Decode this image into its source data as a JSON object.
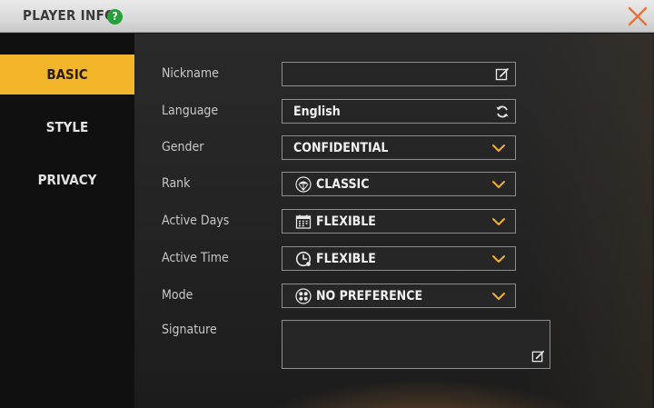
{
  "header": {
    "title": "PLAYER INFO",
    "help_glyph": "?"
  },
  "sidebar": {
    "tabs": [
      {
        "label": "BASIC",
        "active": true
      },
      {
        "label": "STYLE",
        "active": false
      },
      {
        "label": "PRIVACY",
        "active": false
      }
    ]
  },
  "form": {
    "nickname": {
      "label": "Nickname",
      "value": "",
      "trailing_icon": "edit-icon"
    },
    "language": {
      "label": "Language",
      "value": "English",
      "trailing_icon": "refresh-icon"
    },
    "gender": {
      "label": "Gender",
      "value": "CONFIDENTIAL",
      "trailing_icon": "chevron-down-icon"
    },
    "rank": {
      "label": "Rank",
      "value": "CLASSIC",
      "leading_icon": "parachute-icon",
      "trailing_icon": "chevron-down-icon"
    },
    "active_days": {
      "label": "Active Days",
      "value": "FLEXIBLE",
      "leading_icon": "calendar-icon",
      "trailing_icon": "chevron-down-icon"
    },
    "active_time": {
      "label": "Active Time",
      "value": "FLEXIBLE",
      "leading_icon": "clock-icon",
      "trailing_icon": "chevron-down-icon"
    },
    "mode": {
      "label": "Mode",
      "value": "NO PREFERENCE",
      "leading_icon": "modes-icon",
      "trailing_icon": "chevron-down-icon"
    },
    "signature": {
      "label": "Signature",
      "value": "",
      "trailing_icon": "edit-icon"
    }
  },
  "colors": {
    "accent": "#f3b52a",
    "chevron": "#f0b32a",
    "help": "#27a23a",
    "close": "#e8703c"
  }
}
